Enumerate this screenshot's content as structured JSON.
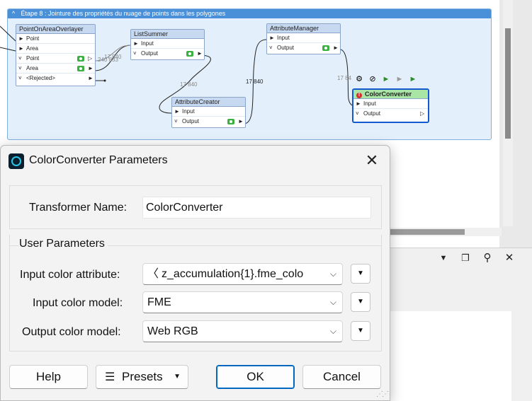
{
  "bookmark": {
    "title": "Étape 8 : Jointure des propriétés du nuage de points dans les polygones",
    "collapse_glyph": "^"
  },
  "nodes": {
    "point_on_area": {
      "title": "PointOnAreaOverlayer",
      "ports": [
        "Point",
        "Area",
        "Point",
        "Area",
        "<Rejected>"
      ]
    },
    "list_summer": {
      "title": "ListSummer",
      "ports": [
        "Input",
        "Output"
      ]
    },
    "attribute_manager": {
      "title": "AttributeManager",
      "ports": [
        "Input",
        "Output"
      ]
    },
    "attribute_creator": {
      "title": "AttributeCreator",
      "ports": [
        "Input",
        "Output"
      ]
    },
    "color_converter": {
      "title": "ColorConverter",
      "ports": [
        "Input",
        "Output"
      ],
      "status_color": "#d32f2f"
    }
  },
  "counts": {
    "pointonarea_to_listsummer_a": "17 840",
    "pointonarea_to_listsummer_b": "240 833",
    "listsummer_to_creator": "17 840",
    "creator_to_manager": "17 840",
    "manager_to_converter": "17 84"
  },
  "node_toolbar_icons": [
    "gear-icon",
    "disable-icon",
    "run-to-icon",
    "run-from-icon",
    "run-icon"
  ],
  "dialog": {
    "title": "ColorConverter Parameters",
    "close_glyph": "✕",
    "transformer_name_label": "Transformer Name:",
    "transformer_name_value": "ColorConverter",
    "user_parameters_legend": "User Parameters",
    "input_color_attribute_label": "Input color attribute:",
    "input_color_attribute_value": "z_accumulation{1}.fme_colo",
    "input_color_model_label": "Input color model:",
    "input_color_model_value": "FME",
    "output_color_model_label": "Output color model:",
    "output_color_model_value": "Web RGB",
    "help_label": "Help",
    "presets_label": "Presets",
    "ok_label": "OK",
    "cancel_label": "Cancel"
  },
  "dock_panel": {
    "buttons": [
      "chevron-down-icon",
      "float-icon",
      "pin-icon",
      "close-icon"
    ]
  },
  "colors": {
    "accent": "#0067c0",
    "selection": "#1559d1",
    "bookmark": "#4a90d9",
    "node_header": "#c7d9f1",
    "converter_header": "#a9e5a4"
  }
}
